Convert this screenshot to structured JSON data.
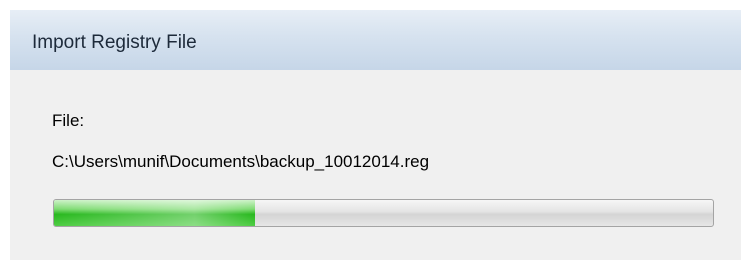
{
  "window": {
    "title": "Import Registry File"
  },
  "content": {
    "file_label": "File:",
    "file_path": "C:\\Users\\munif\\Documents\\backup_10012014.reg"
  },
  "progress": {
    "fraction": 0.305,
    "fill_color": "#28b81e"
  },
  "colors": {
    "titlebar": "#d6e2ef",
    "dialog_background": "#f0f0f0"
  }
}
